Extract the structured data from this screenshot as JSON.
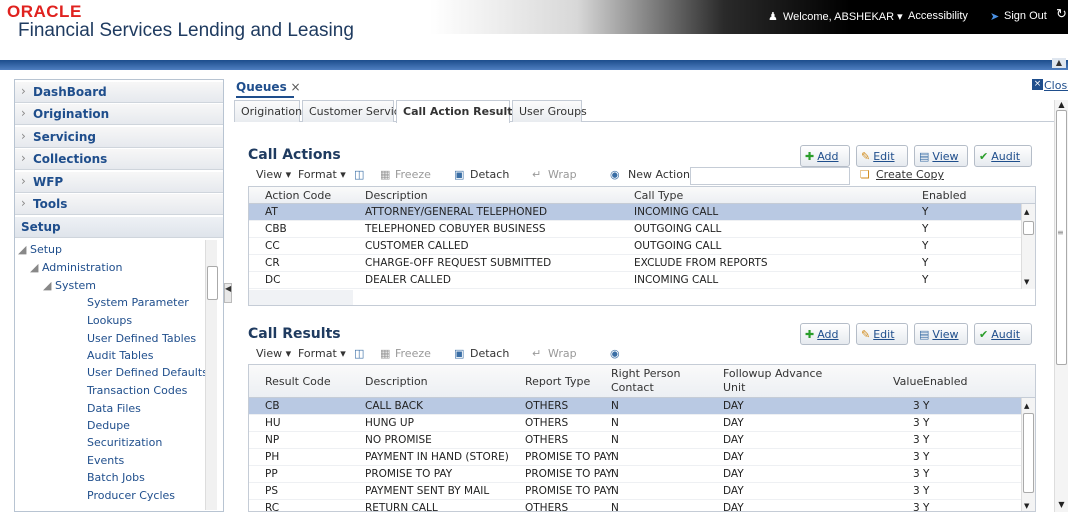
{
  "header": {
    "logo": "ORACLE",
    "app_title": "Financial Services Lending and Leasing",
    "welcome": "Welcome, ABSHEKAR ▾",
    "accessibility": "Accessibility",
    "sign_out": "Sign Out"
  },
  "sidebar": {
    "sections": [
      "DashBoard",
      "Origination",
      "Servicing",
      "Collections",
      "WFP",
      "Tools"
    ],
    "setup_header": "Setup",
    "tree": {
      "root": "Setup",
      "administration": "Administration",
      "system": "System",
      "items": [
        "System Parameter",
        "Lookups",
        "User Defined Tables",
        "Audit Tables",
        "User Defined Defaults",
        "Transaction Codes",
        "Data Files",
        "Dedupe",
        "Securitization",
        "Events",
        "Batch Jobs",
        "Producer Cycles"
      ]
    }
  },
  "main": {
    "tab": "Queues",
    "close": "Close",
    "subtabs": [
      "Origination",
      "Customer Service",
      "Call Action Results",
      "User Groups"
    ],
    "active_subtab": "Call Action Results"
  },
  "call_actions": {
    "title": "Call Actions",
    "buttons": {
      "add": "Add",
      "edit": "Edit",
      "view": "View",
      "audit": "Audit"
    },
    "toolbar": {
      "view": "View ▾",
      "format": "Format ▾",
      "freeze": "Freeze",
      "detach": "Detach",
      "wrap": "Wrap",
      "new_action": "New Action",
      "create_copy": "Create Copy"
    },
    "columns": [
      "Action Code",
      "Description",
      "Call Type",
      "Enabled"
    ],
    "rows": [
      [
        "AT",
        "ATTORNEY/GENERAL TELEPHONED",
        "INCOMING CALL",
        "Y"
      ],
      [
        "CBB",
        "TELEPHONED COBUYER BUSINESS",
        "OUTGOING CALL",
        "Y"
      ],
      [
        "CC",
        "CUSTOMER CALLED",
        "OUTGOING CALL",
        "Y"
      ],
      [
        "CR",
        "CHARGE-OFF REQUEST SUBMITTED",
        "EXCLUDE FROM REPORTS",
        "Y"
      ],
      [
        "DC",
        "DEALER CALLED",
        "INCOMING CALL",
        "Y"
      ]
    ]
  },
  "call_results": {
    "title": "Call Results",
    "buttons": {
      "add": "Add",
      "edit": "Edit",
      "view": "View",
      "audit": "Audit"
    },
    "toolbar": {
      "view": "View ▾",
      "format": "Format ▾",
      "freeze": "Freeze",
      "detach": "Detach",
      "wrap": "Wrap"
    },
    "columns": [
      "Result Code",
      "Description",
      "Report Type",
      "Right Person Contact",
      "Followup Advance Unit",
      "Value",
      "Enabled"
    ],
    "rows": [
      [
        "CB",
        "CALL BACK",
        "OTHERS",
        "N",
        "DAY",
        "3",
        "Y"
      ],
      [
        "HU",
        "HUNG UP",
        "OTHERS",
        "N",
        "DAY",
        "3",
        "Y"
      ],
      [
        "NP",
        "NO PROMISE",
        "OTHERS",
        "N",
        "DAY",
        "3",
        "Y"
      ],
      [
        "PH",
        "PAYMENT IN HAND (STORE)",
        "PROMISE TO PAY",
        "N",
        "DAY",
        "3",
        "Y"
      ],
      [
        "PP",
        "PROMISE TO PAY",
        "PROMISE TO PAY",
        "N",
        "DAY",
        "3",
        "Y"
      ],
      [
        "PS",
        "PAYMENT SENT BY MAIL",
        "PROMISE TO PAY",
        "N",
        "DAY",
        "3",
        "Y"
      ],
      [
        "RC",
        "RETURN CALL",
        "OTHERS",
        "N",
        "DAY",
        "3",
        "Y"
      ]
    ]
  },
  "colors": {
    "brand_red": "#e0221f",
    "nav_blue": "#1f4e8c",
    "selected_row": "#b9c9e3"
  }
}
